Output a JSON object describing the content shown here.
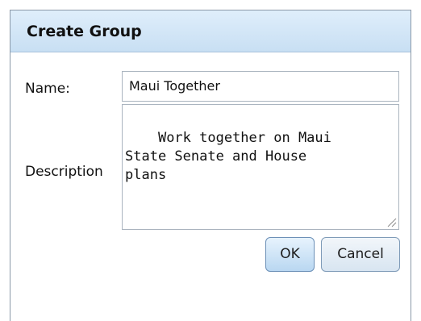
{
  "dialog": {
    "title": "Create Group",
    "name_label": "Name:",
    "name_value": "Maui Together",
    "description_label": "Description",
    "description_value": "Work together on Maui\nState Senate and House\nplans",
    "ok_label": "OK",
    "cancel_label": "Cancel"
  }
}
